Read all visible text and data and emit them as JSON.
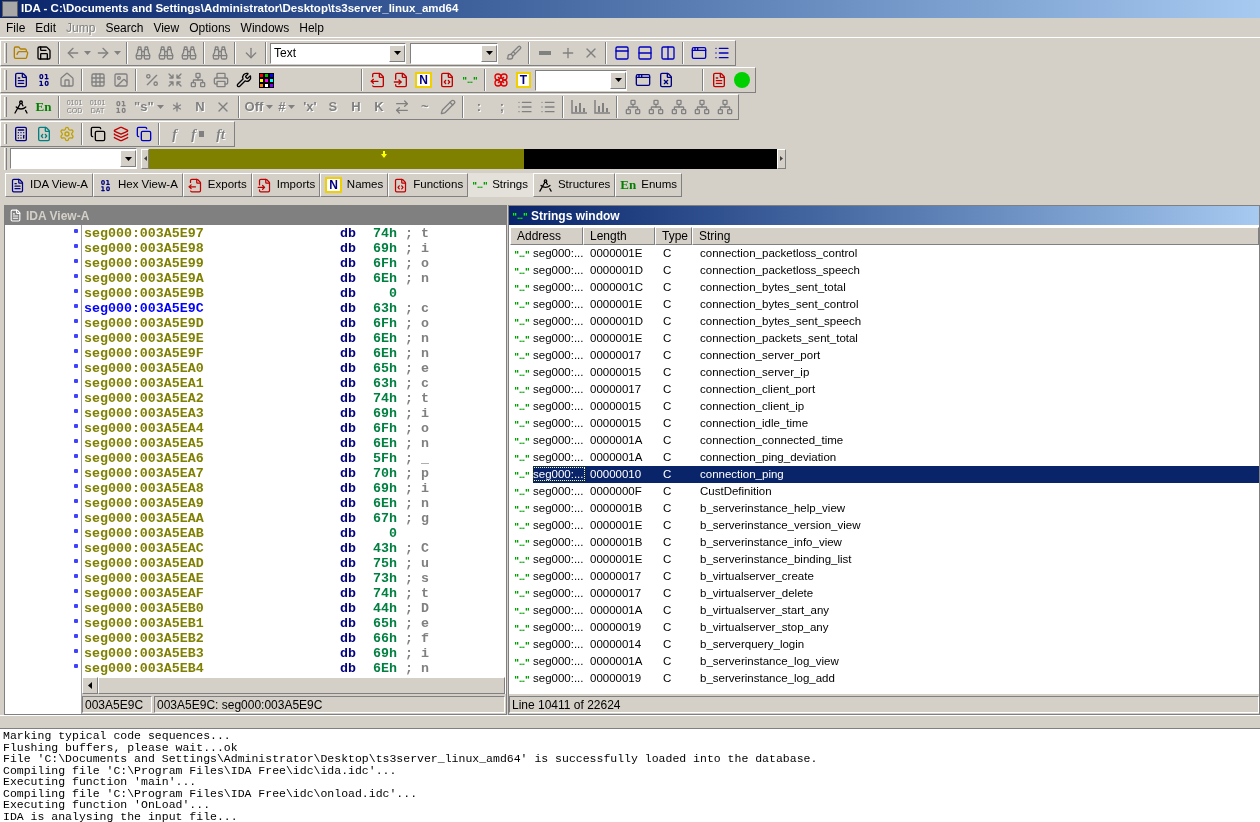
{
  "window": {
    "title": "IDA - C:\\Documents and Settings\\Administrator\\Desktop\\ts3server_linux_amd64"
  },
  "menu": [
    {
      "label": "File",
      "disabled": false
    },
    {
      "label": "Edit",
      "disabled": false
    },
    {
      "label": "Jump",
      "disabled": true
    },
    {
      "label": "Search",
      "disabled": false
    },
    {
      "label": "View",
      "disabled": false
    },
    {
      "label": "Options",
      "disabled": false
    },
    {
      "label": "Windows",
      "disabled": false
    },
    {
      "label": "Help",
      "disabled": false
    }
  ],
  "toolbars": [
    {
      "combo": {
        "value": "Text"
      },
      "buttons": [
        {
          "disabled": false
        },
        {
          "disabled": false
        },
        {
          "disabled": true
        },
        {
          "disabled": true
        },
        {
          "disabled": true
        },
        {
          "disabled": true
        },
        {
          "disabled": true
        },
        {
          "disabled": true
        },
        {
          "disabled": true
        },
        {
          "disabled": true
        },
        {
          "disabled": true
        },
        {
          "disabled": true
        },
        {
          "disabled": true
        },
        {
          "disabled": false
        },
        {
          "disabled": false
        },
        {
          "disabled": false
        },
        {
          "disabled": false
        },
        {
          "disabled": false
        }
      ]
    },
    {
      "buttons": [
        {
          "disabled": false
        },
        {
          "disabled": false
        },
        {
          "disabled": true
        },
        {
          "disabled": true
        },
        {
          "disabled": true
        },
        {
          "disabled": true
        },
        {
          "disabled": true
        },
        {
          "disabled": true
        },
        {
          "disabled": true
        },
        {
          "disabled": false
        },
        {
          "disabled": false
        },
        {
          "disabled": false
        },
        {
          "disabled": false
        },
        {
          "disabled": false,
          "glyph": "N"
        },
        {
          "disabled": false
        },
        {
          "disabled": false
        },
        {
          "disabled": false
        },
        {
          "disabled": false,
          "glyph": "T"
        },
        {
          "disabled": false
        },
        {
          "disabled": false
        },
        {
          "disabled": false
        },
        {
          "disabled": false
        }
      ]
    },
    {
      "buttons": [
        {
          "disabled": false
        },
        {
          "disabled": false,
          "glyph": "En"
        },
        {
          "disabled": true,
          "glyph": "0101 COD"
        },
        {
          "disabled": true,
          "glyph": "0101 DAT"
        },
        {
          "disabled": true
        },
        {
          "disabled": true,
          "glyph": "\"s\""
        },
        {
          "disabled": true
        },
        {
          "disabled": true,
          "glyph": "N"
        },
        {
          "disabled": true
        },
        {
          "disabled": true,
          "glyph": "Off"
        },
        {
          "disabled": true,
          "glyph": "#"
        },
        {
          "disabled": true,
          "glyph": "'x'"
        },
        {
          "disabled": true,
          "glyph": "S"
        },
        {
          "disabled": true,
          "glyph": "H"
        },
        {
          "disabled": true,
          "glyph": "K"
        },
        {
          "disabled": true
        },
        {
          "disabled": true,
          "glyph": "~"
        },
        {
          "disabled": true
        },
        {
          "disabled": true,
          "glyph": ":"
        },
        {
          "disabled": true,
          "glyph": ";"
        },
        {
          "disabled": true
        },
        {
          "disabled": true
        },
        {
          "disabled": true
        },
        {
          "disabled": true
        },
        {
          "disabled": true
        },
        {
          "disabled": true
        },
        {
          "disabled": true
        },
        {
          "disabled": true
        },
        {
          "disabled": true
        }
      ]
    },
    {
      "buttons": [
        {
          "disabled": false
        },
        {
          "disabled": false
        },
        {
          "disabled": false
        },
        {
          "disabled": false
        },
        {
          "disabled": false
        },
        {
          "disabled": false
        },
        {
          "disabled": true,
          "glyph": "f"
        },
        {
          "disabled": true,
          "glyph": "f"
        },
        {
          "disabled": true,
          "glyph": "ft"
        }
      ]
    }
  ],
  "tabs": [
    {
      "label": "IDA View-A",
      "selected": false
    },
    {
      "label": "Hex View-A",
      "selected": false
    },
    {
      "label": "Exports",
      "selected": false
    },
    {
      "label": "Imports",
      "selected": false
    },
    {
      "label": "Names",
      "selected": false,
      "glyph": "N"
    },
    {
      "label": "Functions",
      "selected": false
    },
    {
      "label": "Strings",
      "selected": true
    },
    {
      "label": "Structures",
      "selected": false
    },
    {
      "label": "Enums",
      "selected": false,
      "glyph": "En"
    }
  ],
  "ida_view": {
    "title": "IDA View-A",
    "active": false,
    "rows": [
      {
        "address": "seg000:003A5E97",
        "directive": "db",
        "value": "74h",
        "comment": "; t",
        "selected": false
      },
      {
        "address": "seg000:003A5E98",
        "directive": "db",
        "value": "69h",
        "comment": "; i",
        "selected": false
      },
      {
        "address": "seg000:003A5E99",
        "directive": "db",
        "value": "6Fh",
        "comment": "; o",
        "selected": false
      },
      {
        "address": "seg000:003A5E9A",
        "directive": "db",
        "value": "6Eh",
        "comment": "; n",
        "selected": false
      },
      {
        "address": "seg000:003A5E9B",
        "directive": "db",
        "value": "0",
        "selected": false
      },
      {
        "address": "seg000:003A5E9C",
        "directive": "db",
        "value": "63h",
        "comment": "; c",
        "selected": true
      },
      {
        "address": "seg000:003A5E9D",
        "directive": "db",
        "value": "6Fh",
        "comment": "; o",
        "selected": false
      },
      {
        "address": "seg000:003A5E9E",
        "directive": "db",
        "value": "6Eh",
        "comment": "; n",
        "selected": false
      },
      {
        "address": "seg000:003A5E9F",
        "directive": "db",
        "value": "6Eh",
        "comment": "; n",
        "selected": false
      },
      {
        "address": "seg000:003A5EA0",
        "directive": "db",
        "value": "65h",
        "comment": "; e",
        "selected": false
      },
      {
        "address": "seg000:003A5EA1",
        "directive": "db",
        "value": "63h",
        "comment": "; c",
        "selected": false
      },
      {
        "address": "seg000:003A5EA2",
        "directive": "db",
        "value": "74h",
        "comment": "; t",
        "selected": false
      },
      {
        "address": "seg000:003A5EA3",
        "directive": "db",
        "value": "69h",
        "comment": "; i",
        "selected": false
      },
      {
        "address": "seg000:003A5EA4",
        "directive": "db",
        "value": "6Fh",
        "comment": "; o",
        "selected": false
      },
      {
        "address": "seg000:003A5EA5",
        "directive": "db",
        "value": "6Eh",
        "comment": "; n",
        "selected": false
      },
      {
        "address": "seg000:003A5EA6",
        "directive": "db",
        "value": "5Fh",
        "comment": "; _",
        "selected": false
      },
      {
        "address": "seg000:003A5EA7",
        "directive": "db",
        "value": "70h",
        "comment": "; p",
        "selected": false
      },
      {
        "address": "seg000:003A5EA8",
        "directive": "db",
        "value": "69h",
        "comment": "; i",
        "selected": false
      },
      {
        "address": "seg000:003A5EA9",
        "directive": "db",
        "value": "6Eh",
        "comment": "; n",
        "selected": false
      },
      {
        "address": "seg000:003A5EAA",
        "directive": "db",
        "value": "67h",
        "comment": "; g",
        "selected": false
      },
      {
        "address": "seg000:003A5EAB",
        "directive": "db",
        "value": "0",
        "selected": false
      },
      {
        "address": "seg000:003A5EAC",
        "directive": "db",
        "value": "43h",
        "comment": "; C",
        "selected": false
      },
      {
        "address": "seg000:003A5EAD",
        "directive": "db",
        "value": "75h",
        "comment": "; u",
        "selected": false
      },
      {
        "address": "seg000:003A5EAE",
        "directive": "db",
        "value": "73h",
        "comment": "; s",
        "selected": false
      },
      {
        "address": "seg000:003A5EAF",
        "directive": "db",
        "value": "74h",
        "comment": "; t",
        "selected": false
      },
      {
        "address": "seg000:003A5EB0",
        "directive": "db",
        "value": "44h",
        "comment": "; D",
        "selected": false
      },
      {
        "address": "seg000:003A5EB1",
        "directive": "db",
        "value": "65h",
        "comment": "; e",
        "selected": false
      },
      {
        "address": "seg000:003A5EB2",
        "directive": "db",
        "value": "66h",
        "comment": "; f",
        "selected": false
      },
      {
        "address": "seg000:003A5EB3",
        "directive": "db",
        "value": "69h",
        "comment": "; i",
        "selected": false
      },
      {
        "address": "seg000:003A5EB4",
        "directive": "db",
        "value": "6Eh",
        "comment": "; n",
        "selected": false
      }
    ],
    "status": [
      "003A5E9C",
      "003A5E9C: seg000:003A5E9C"
    ]
  },
  "strings_window": {
    "title": "Strings window",
    "active": true,
    "columns": [
      "Address",
      "Length",
      "Type",
      "String"
    ],
    "rows": [
      {
        "address": "seg000:...",
        "length": "0000001E",
        "type": "C",
        "string": "connection_packetloss_control",
        "selected": false
      },
      {
        "address": "seg000:...",
        "length": "0000001D",
        "type": "C",
        "string": "connection_packetloss_speech",
        "selected": false
      },
      {
        "address": "seg000:...",
        "length": "0000001C",
        "type": "C",
        "string": "connection_bytes_sent_total",
        "selected": false
      },
      {
        "address": "seg000:...",
        "length": "0000001E",
        "type": "C",
        "string": "connection_bytes_sent_control",
        "selected": false
      },
      {
        "address": "seg000:...",
        "length": "0000001D",
        "type": "C",
        "string": "connection_bytes_sent_speech",
        "selected": false
      },
      {
        "address": "seg000:...",
        "length": "0000001E",
        "type": "C",
        "string": "connection_packets_sent_total",
        "selected": false
      },
      {
        "address": "seg000:...",
        "length": "00000017",
        "type": "C",
        "string": "connection_server_port",
        "selected": false
      },
      {
        "address": "seg000:...",
        "length": "00000015",
        "type": "C",
        "string": "connection_server_ip",
        "selected": false
      },
      {
        "address": "seg000:...",
        "length": "00000017",
        "type": "C",
        "string": "connection_client_port",
        "selected": false
      },
      {
        "address": "seg000:...",
        "length": "00000015",
        "type": "C",
        "string": "connection_client_ip",
        "selected": false
      },
      {
        "address": "seg000:...",
        "length": "00000015",
        "type": "C",
        "string": "connection_idle_time",
        "selected": false
      },
      {
        "address": "seg000:...",
        "length": "0000001A",
        "type": "C",
        "string": "connection_connected_time",
        "selected": false
      },
      {
        "address": "seg000:...",
        "length": "0000001A",
        "type": "C",
        "string": "connection_ping_deviation",
        "selected": false
      },
      {
        "address": "seg000:...",
        "length": "00000010",
        "type": "C",
        "string": "connection_ping",
        "selected": true
      },
      {
        "address": "seg000:...",
        "length": "0000000F",
        "type": "C",
        "string": "CustDefinition",
        "selected": false
      },
      {
        "address": "seg000:...",
        "length": "0000001B",
        "type": "C",
        "string": "b_serverinstance_help_view",
        "selected": false
      },
      {
        "address": "seg000:...",
        "length": "0000001E",
        "type": "C",
        "string": "b_serverinstance_version_view",
        "selected": false
      },
      {
        "address": "seg000:...",
        "length": "0000001B",
        "type": "C",
        "string": "b_serverinstance_info_view",
        "selected": false
      },
      {
        "address": "seg000:...",
        "length": "0000001E",
        "type": "C",
        "string": "b_serverinstance_binding_list",
        "selected": false
      },
      {
        "address": "seg000:...",
        "length": "00000017",
        "type": "C",
        "string": "b_virtualserver_create",
        "selected": false
      },
      {
        "address": "seg000:...",
        "length": "00000017",
        "type": "C",
        "string": "b_virtualserver_delete",
        "selected": false
      },
      {
        "address": "seg000:...",
        "length": "0000001A",
        "type": "C",
        "string": "b_virtualserver_start_any",
        "selected": false
      },
      {
        "address": "seg000:...",
        "length": "00000019",
        "type": "C",
        "string": "b_virtualserver_stop_any",
        "selected": false
      },
      {
        "address": "seg000:...",
        "length": "00000014",
        "type": "C",
        "string": "b_serverquery_login",
        "selected": false
      },
      {
        "address": "seg000:...",
        "length": "0000001A",
        "type": "C",
        "string": "b_serverinstance_log_view",
        "selected": false
      },
      {
        "address": "seg000:...",
        "length": "00000019",
        "type": "C",
        "string": "b_serverinstance_log_add",
        "selected": false
      }
    ],
    "status": "Line 10411 of 22624"
  },
  "output": {
    "lines": [
      "Marking typical code sequences...",
      "Flushing buffers, please wait...ok",
      "File 'C:\\Documents and Settings\\Administrator\\Desktop\\ts3server_linux_amd64' is successfully loaded into the database.",
      "Compiling file 'C:\\Program Files\\IDA Free\\idc\\ida.idc'...",
      "Executing function 'main'...",
      "Compiling file 'C:\\Program Files\\IDA Free\\idc\\onload.idc'...",
      "Executing function 'OnLoad'...",
      "IDA is analysing the input file..."
    ]
  }
}
